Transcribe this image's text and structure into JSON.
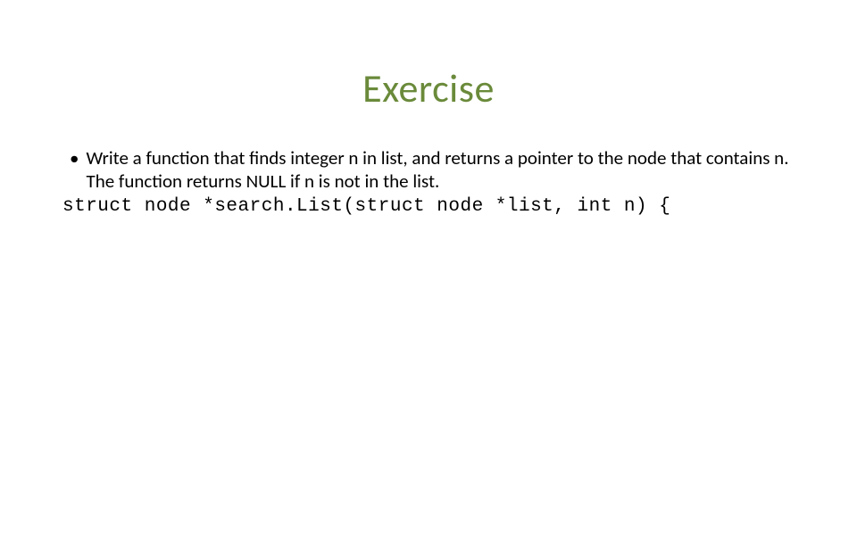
{
  "title": "Exercise",
  "bullet": {
    "marker": "•",
    "text": "Write a function that finds integer n in list, and returns a pointer to the node that contains n. The function returns NULL if n is not in the list."
  },
  "code": "struct node *search.List(struct node *list, int n) {"
}
